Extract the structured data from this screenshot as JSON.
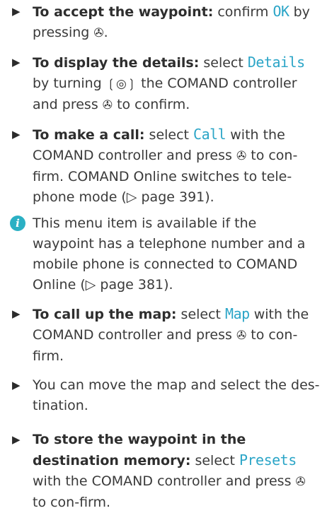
{
  "steps": [
    {
      "bullet": "▶",
      "lead": "To accept the waypoint:",
      "t1": " confirm ",
      "ui": "OK",
      "t2": " by pressing ",
      "press": "✇",
      "t3": "."
    },
    {
      "bullet": "▶",
      "lead": "To display the details:",
      "t1": " select ",
      "ui": "Details",
      "t2": " by turning ",
      "turn": "❲◎❳",
      "t3": " the COMAND controller and press ",
      "press": "✇",
      "t4": " to confirm."
    },
    {
      "bullet": "▶",
      "lead": "To make a call:",
      "t1": " select ",
      "ui": "Call",
      "t2": " with the COMAND controller and press ",
      "press": "✇",
      "t3": " to con-firm. COMAND Online switches to tele-phone mode (▷ page 391)."
    }
  ],
  "info": {
    "icon": "i",
    "text": "This menu item is available if the waypoint has a telephone number and a mobile phone is connected to COMAND Online (▷ page 381)."
  },
  "steps2": [
    {
      "bullet": "▶",
      "lead": "To call up the map:",
      "t1": " select ",
      "ui": "Map",
      "t2": " with the COMAND controller and press ",
      "press": "✇",
      "t3": " to con-firm."
    },
    {
      "bullet": "▶",
      "text": "You can move the map and select the des-tination."
    },
    {
      "bullet": "▶",
      "lead": "To store the waypoint in the destination memory:",
      "t1": " select ",
      "ui": "Presets",
      "t2": " with the COMAND controller and press ",
      "press": "✇",
      "t3": " to con-firm."
    }
  ],
  "colors": {
    "accent": "#2ba5c7",
    "info_icon": "#2bb0c4",
    "text": "#3a3a3a"
  },
  "icons": {
    "bullet": "triangle-right-icon",
    "press": "controller-press-icon",
    "turn": "controller-turn-icon",
    "info": "info-icon"
  }
}
